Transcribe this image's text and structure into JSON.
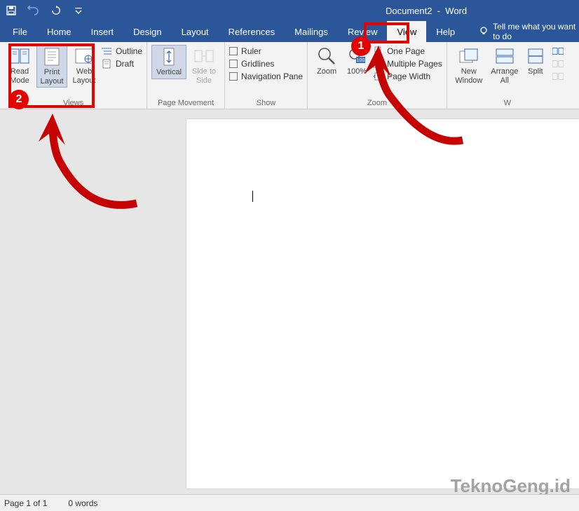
{
  "title": {
    "doc": "Document2",
    "sep": "-",
    "app": "Word"
  },
  "qat": {
    "save": "Save",
    "undo": "Undo",
    "redo": "Repeat"
  },
  "tabs": {
    "file": "File",
    "home": "Home",
    "insert": "Insert",
    "design": "Design",
    "layout": "Layout",
    "references": "References",
    "mailings": "Mailings",
    "review": "Review",
    "view": "View",
    "help": "Help",
    "tellme": "Tell me what you want to do"
  },
  "ribbon": {
    "views": {
      "label": "Views",
      "read_mode": "Read Mode",
      "print_layout": "Print Layout",
      "web_layout": "Web Layout",
      "outline": "Outline",
      "draft": "Draft"
    },
    "page_movement": {
      "label": "Page Movement",
      "vertical": "Vertical",
      "side_to_side": "Side to Side"
    },
    "show": {
      "label": "Show",
      "ruler": "Ruler",
      "gridlines": "Gridlines",
      "nav_pane": "Navigation Pane"
    },
    "zoom": {
      "label": "Zoom",
      "zoom": "Zoom",
      "hundred": "100%",
      "one_page": "One Page",
      "multiple_pages": "Multiple Pages",
      "page_width": "Page Width"
    },
    "window": {
      "label": "W",
      "new_window": "New Window",
      "arrange_all": "Arrange All",
      "split": "Split"
    }
  },
  "status": {
    "page": "Page 1 of 1",
    "words": "0 words"
  },
  "annotations": {
    "step1": "1",
    "step2": "2"
  },
  "watermark": "TeknoGeng.id"
}
